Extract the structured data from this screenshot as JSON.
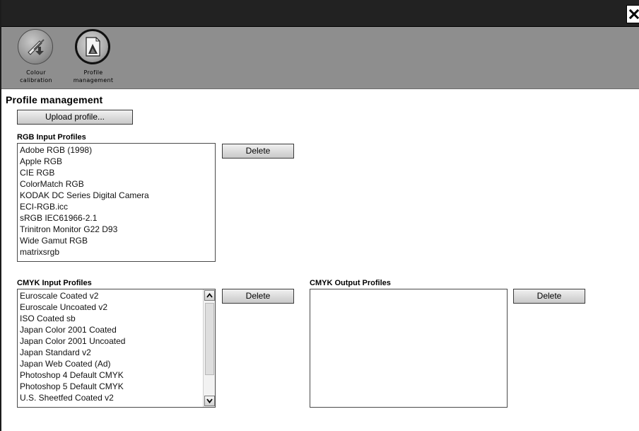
{
  "window": {
    "close_icon": "close-icon"
  },
  "toolbar": {
    "tools": [
      {
        "label_line1": "Colour",
        "label_line2": "calibration",
        "icon": "colour-calibration-icon"
      },
      {
        "label_line1": "Profile",
        "label_line2": "management",
        "icon": "profile-management-icon"
      }
    ]
  },
  "page": {
    "title": "Profile management",
    "upload_label": "Upload profile..."
  },
  "rgb_input": {
    "label": "RGB Input Profiles",
    "delete_label": "Delete",
    "items": [
      "Adobe RGB (1998)",
      "Apple RGB",
      "CIE RGB",
      "ColorMatch RGB",
      "KODAK DC Series Digital Camera",
      "ECI-RGB.icc",
      "sRGB IEC61966-2.1",
      "Trinitron Monitor G22 D93",
      "Wide Gamut RGB",
      "matrixsrgb"
    ]
  },
  "cmyk_input": {
    "label": "CMYK Input Profiles",
    "delete_label": "Delete",
    "items": [
      "Euroscale Coated v2",
      "Euroscale Uncoated v2",
      "ISO Coated sb",
      "Japan Color 2001 Coated",
      "Japan Color 2001 Uncoated",
      "Japan Standard v2",
      "Japan Web Coated (Ad)",
      "Photoshop 4 Default CMYK",
      "Photoshop 5 Default CMYK",
      "U.S. Sheetfed Coated v2"
    ]
  },
  "cmyk_output": {
    "label": "CMYK Output Profiles",
    "delete_label": "Delete",
    "items": []
  },
  "colors": {
    "titlebar": "#222222",
    "toolbar": "#8e8e8e",
    "button_top": "#f0f0f0",
    "button_bottom": "#c9c9c9"
  }
}
